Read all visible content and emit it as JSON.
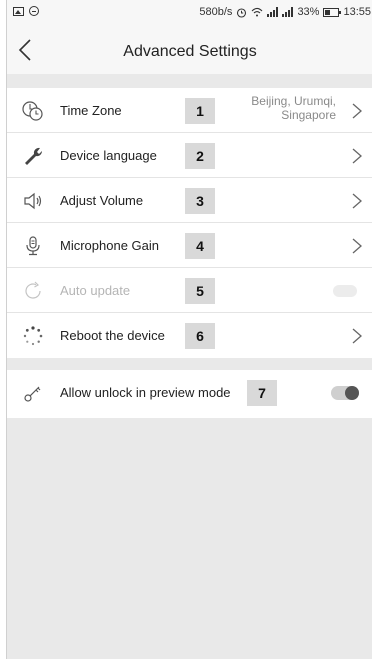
{
  "status_bar": {
    "network_speed": "580b/s",
    "battery_percent": "33%",
    "time": "13:55"
  },
  "header": {
    "title": "Advanced Settings"
  },
  "settings": [
    {
      "label": "Time Zone",
      "badge": "1",
      "value_line1": "Beijing, Urumqi,",
      "value_line2": "Singapore",
      "icon": "clock-icon"
    },
    {
      "label": "Device language",
      "badge": "2",
      "icon": "wrench-icon"
    },
    {
      "label": "Adjust Volume",
      "badge": "3",
      "icon": "speaker-icon"
    },
    {
      "label": "Microphone Gain",
      "badge": "4",
      "icon": "microphone-icon"
    },
    {
      "label": "Auto update",
      "badge": "5",
      "icon": "refresh-icon",
      "disabled": true
    },
    {
      "label": "Reboot the device",
      "badge": "6",
      "icon": "loading-spinner-icon"
    }
  ],
  "unlock": {
    "label": "Allow unlock in preview mode",
    "badge": "7",
    "icon": "key-icon",
    "enabled": false
  }
}
